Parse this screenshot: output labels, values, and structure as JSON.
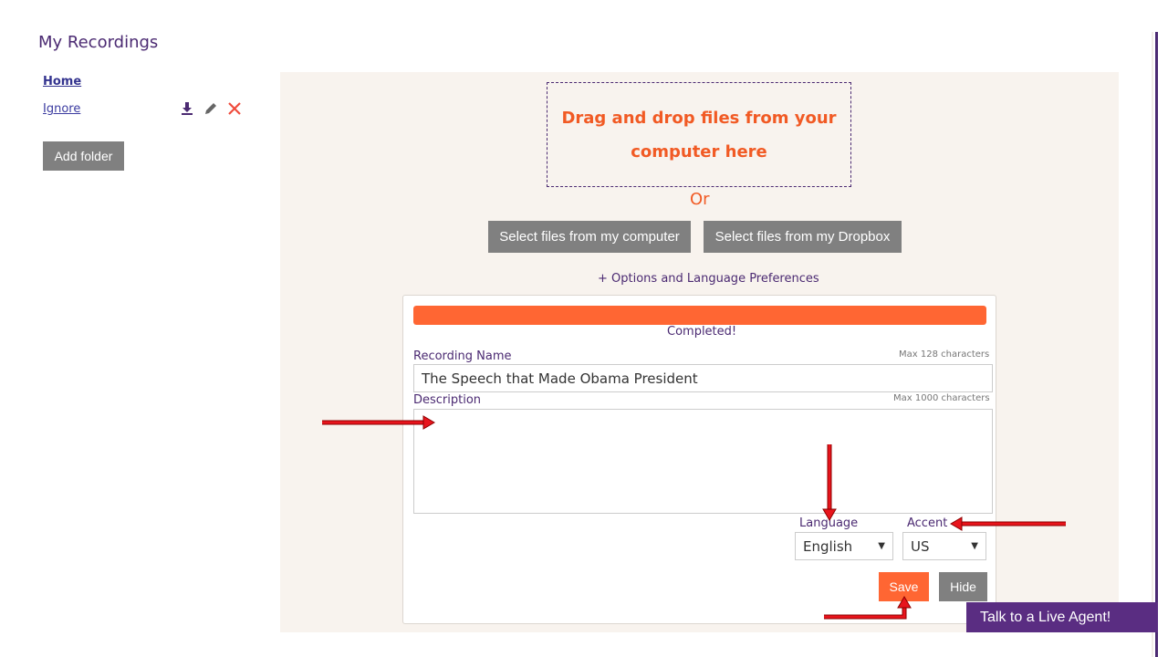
{
  "sidebar": {
    "title": "My Recordings",
    "links": [
      "Home",
      "Ignore"
    ],
    "add_folder_label": "Add folder"
  },
  "upload": {
    "drop_line1": "Drag and drop files from your",
    "drop_line2": "computer here",
    "or_label": "Or",
    "select_computer_label": "Select files from my computer",
    "select_dropbox_label": "Select files from my Dropbox",
    "options_link": "+ Options and Language Preferences"
  },
  "form": {
    "progress_percent": 100,
    "status_text": "Completed!",
    "recording_name_label": "Recording Name",
    "recording_name_hint": "Max 128 characters",
    "recording_name_value": "The Speech that Made Obama President",
    "description_label": "Description",
    "description_hint": "Max 1000 characters",
    "description_value": "",
    "language_label": "Language",
    "language_value": "English",
    "accent_label": "Accent",
    "accent_value": "US",
    "save_label": "Save",
    "hide_label": "Hide"
  },
  "chat": {
    "live_agent_label": "Talk to a Live Agent!"
  },
  "colors": {
    "brand_purple": "#4b2a72",
    "accent_orange": "#ff6633",
    "panel_bg": "#f8f3ee",
    "annotation_red": "#e8141c"
  },
  "icons": [
    "download-icon",
    "edit-pencil-icon",
    "delete-x-icon",
    "caret-down-icon"
  ]
}
